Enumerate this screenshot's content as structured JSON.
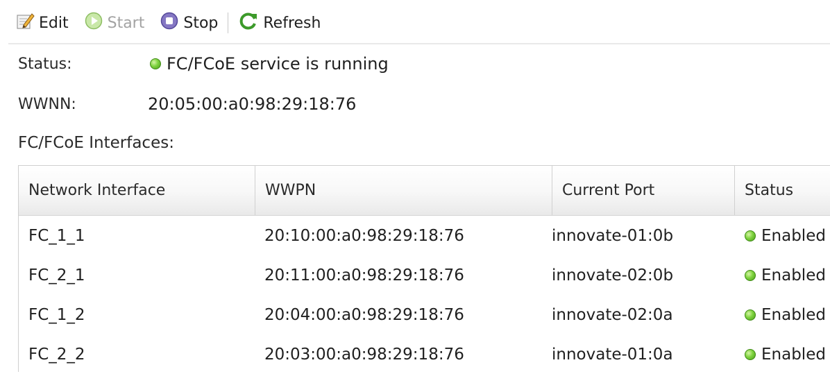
{
  "toolbar": {
    "edit_label": "Edit",
    "start_label": "Start",
    "stop_label": "Stop",
    "refresh_label": "Refresh"
  },
  "info": {
    "status_label": "Status:",
    "status_value": "FC/FCoE service is running",
    "wwnn_label": "WWNN:",
    "wwnn_value": "20:05:00:a0:98:29:18:76",
    "interfaces_label": "FC/FCoE Interfaces:"
  },
  "table": {
    "headers": [
      "Network Interface",
      "WWPN",
      "Current Port",
      "Status"
    ],
    "rows": [
      {
        "network_interface": "FC_1_1",
        "wwpn": "20:10:00:a0:98:29:18:76",
        "current_port": "innovate-01:0b",
        "status": "Enabled"
      },
      {
        "network_interface": "FC_2_1",
        "wwpn": "20:11:00:a0:98:29:18:76",
        "current_port": "innovate-02:0b",
        "status": "Enabled"
      },
      {
        "network_interface": "FC_1_2",
        "wwpn": "20:04:00:a0:98:29:18:76",
        "current_port": "innovate-02:0a",
        "status": "Enabled"
      },
      {
        "network_interface": "FC_2_2",
        "wwpn": "20:03:00:a0:98:29:18:76",
        "current_port": "innovate-01:0a",
        "status": "Enabled"
      }
    ]
  },
  "icons": {
    "edit": "edit-icon",
    "start": "start-icon",
    "stop": "stop-icon",
    "refresh": "refresh-icon",
    "status": "status-ok-icon"
  },
  "colors": {
    "status_ok": "#6cc233",
    "disabled_text": "#a3a3a3",
    "refresh_green": "#3c9a2a",
    "stop_purple": "#7a6bb5"
  }
}
